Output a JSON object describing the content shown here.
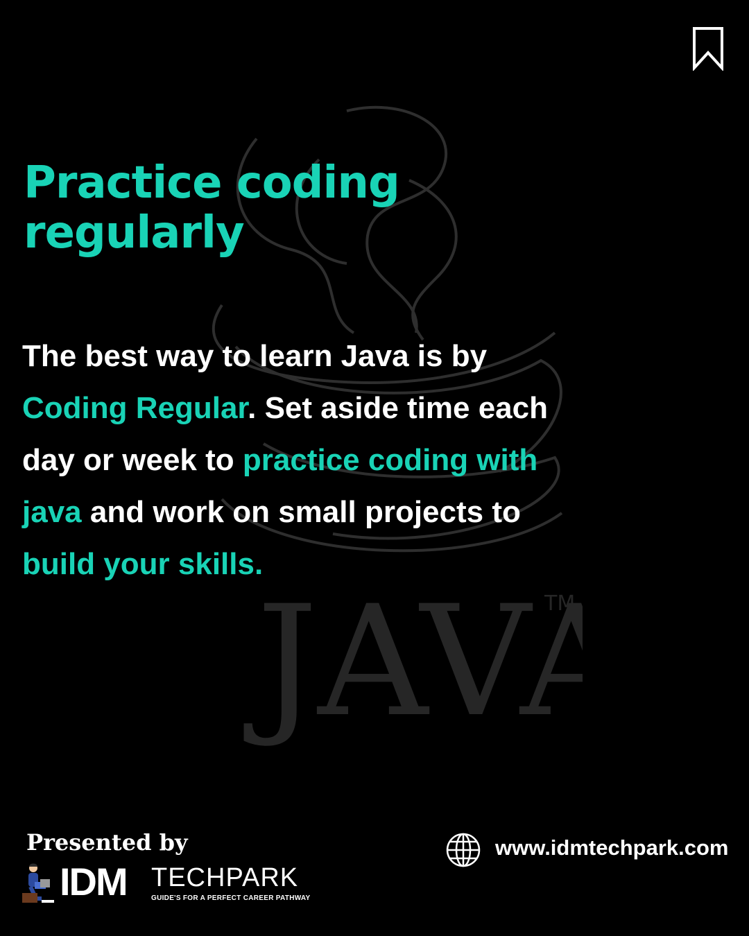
{
  "title": "Practice coding regularly",
  "watermark": {
    "text": "JAVA",
    "tm": "TM"
  },
  "body": {
    "p1": "The best way to learn Java is by ",
    "h1": "Coding Regular",
    "p2": ". Set aside time each day or week to ",
    "h2": "practice coding with java",
    "p3": " and work on small projects to ",
    "h3": "build your skills."
  },
  "footer": {
    "presented_by": "Presented by",
    "logo_main": "IDM",
    "logo_sub": "TECHPARK",
    "logo_tagline": "GUIDE'S FOR A PERFECT CAREER PATHWAY",
    "website": "www.idmtechpark.com"
  },
  "colors": {
    "accent": "#19d3b6",
    "background": "#000000",
    "text": "#ffffff"
  },
  "icons": {
    "top_right": "bookmark-icon",
    "website": "globe-icon"
  }
}
